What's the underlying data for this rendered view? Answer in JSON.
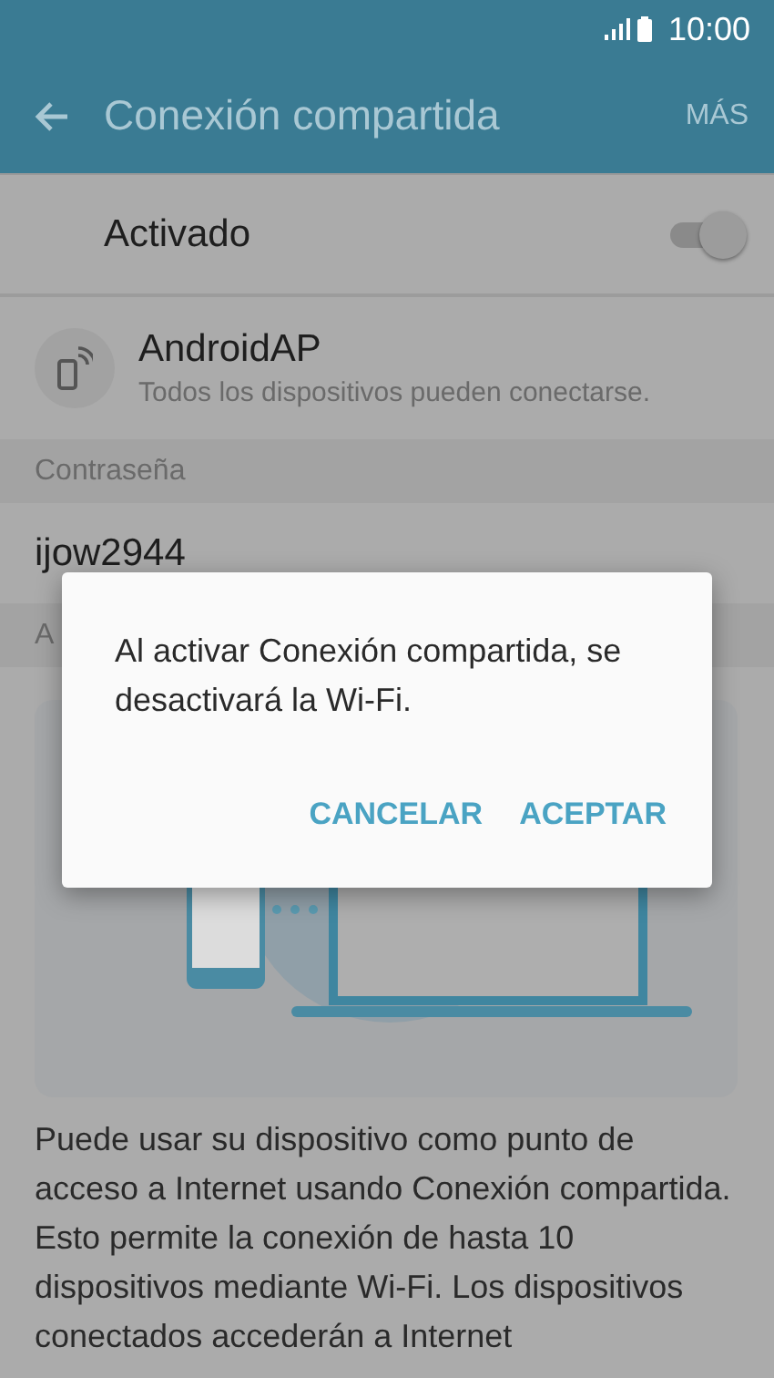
{
  "status_bar": {
    "time": "10:00"
  },
  "app_bar": {
    "title": "Conexión compartida",
    "menu": "MÁS"
  },
  "master_switch": {
    "label": "Activado",
    "on": true
  },
  "network": {
    "name": "AndroidAP",
    "description": "Todos los dispositivos pueden conectarse."
  },
  "password_section": {
    "header": "Contraseña",
    "value": "ijow2944"
  },
  "help_section": {
    "header": "A",
    "text": "Puede usar su dispositivo como punto de acceso a Internet usando Conexión compartida. Esto permite la conexión de hasta 10 dispositivos mediante Wi-Fi. Los dispositivos conectados accederán a Internet"
  },
  "dialog": {
    "message": "Al activar Conexión compartida, se desactivará la Wi-Fi.",
    "buttons": [
      "CANCELAR",
      "ACEPTAR"
    ]
  }
}
